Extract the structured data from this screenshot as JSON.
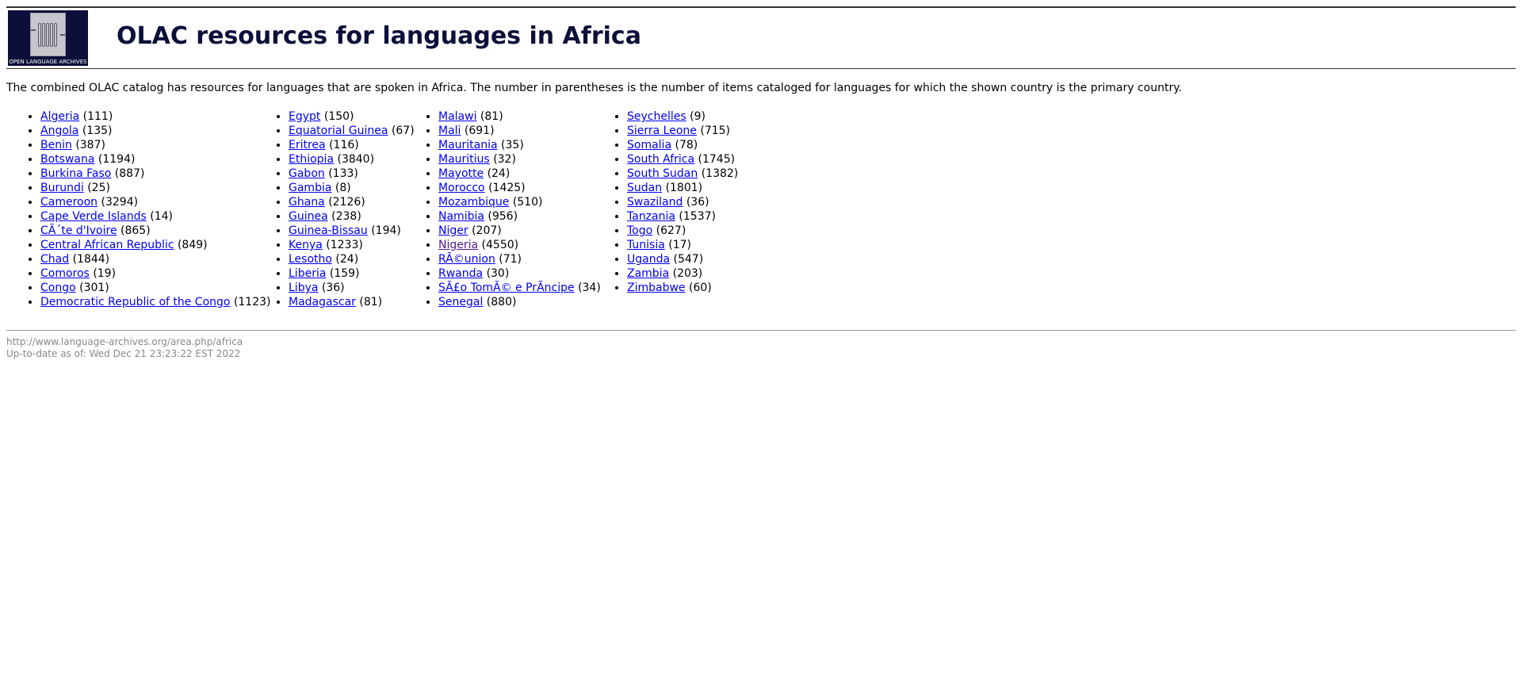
{
  "header": {
    "logo_text": "OPEN LANGUAGE ARCHIVES",
    "title": "OLAC resources for languages in Africa"
  },
  "intro": "The combined OLAC catalog has resources for languages that are spoken in Africa. The number in parentheses is the number of items cataloged for languages for which the shown country is the primary country.",
  "columns": [
    [
      {
        "name": "Algeria",
        "count": "(111)"
      },
      {
        "name": "Angola",
        "count": "(135)"
      },
      {
        "name": "Benin",
        "count": "(387)"
      },
      {
        "name": "Botswana",
        "count": "(1194)"
      },
      {
        "name": "Burkina Faso",
        "count": "(887)"
      },
      {
        "name": "Burundi",
        "count": "(25)"
      },
      {
        "name": "Cameroon",
        "count": "(3294)"
      },
      {
        "name": "Cape Verde Islands",
        "count": "(14)"
      },
      {
        "name": "CÃ´te d'Ivoire",
        "count": "(865)"
      },
      {
        "name": "Central African Republic",
        "count": "(849)"
      },
      {
        "name": "Chad",
        "count": "(1844)"
      },
      {
        "name": "Comoros",
        "count": "(19)"
      },
      {
        "name": "Congo",
        "count": "(301)"
      },
      {
        "name": "Democratic Republic of the Congo",
        "count": "(1123)"
      }
    ],
    [
      {
        "name": "Egypt",
        "count": "(150)"
      },
      {
        "name": "Equatorial Guinea",
        "count": "(67)"
      },
      {
        "name": "Eritrea",
        "count": "(116)"
      },
      {
        "name": "Ethiopia",
        "count": "(3840)"
      },
      {
        "name": "Gabon",
        "count": "(133)"
      },
      {
        "name": "Gambia",
        "count": "(8)"
      },
      {
        "name": "Ghana",
        "count": "(2126)"
      },
      {
        "name": "Guinea",
        "count": "(238)"
      },
      {
        "name": "Guinea-Bissau",
        "count": "(194)"
      },
      {
        "name": "Kenya",
        "count": "(1233)"
      },
      {
        "name": "Lesotho",
        "count": "(24)"
      },
      {
        "name": "Liberia",
        "count": "(159)"
      },
      {
        "name": "Libya",
        "count": "(36)"
      },
      {
        "name": "Madagascar",
        "count": "(81)"
      }
    ],
    [
      {
        "name": "Malawi",
        "count": "(81)"
      },
      {
        "name": "Mali",
        "count": "(691)"
      },
      {
        "name": "Mauritania",
        "count": "(35)"
      },
      {
        "name": "Mauritius",
        "count": "(32)"
      },
      {
        "name": "Mayotte",
        "count": "(24)"
      },
      {
        "name": "Morocco",
        "count": "(1425)"
      },
      {
        "name": "Mozambique",
        "count": "(510)"
      },
      {
        "name": "Namibia",
        "count": "(956)"
      },
      {
        "name": "Niger",
        "count": "(207)"
      },
      {
        "name": "Nigeria",
        "count": "(4550)",
        "visited": true
      },
      {
        "name": "RÃ©union",
        "count": "(71)"
      },
      {
        "name": "Rwanda",
        "count": "(30)"
      },
      {
        "name": "SÃ£o TomÃ© e PrÃ­ncipe",
        "count": "(34)"
      },
      {
        "name": "Senegal",
        "count": "(880)"
      }
    ],
    [
      {
        "name": "Seychelles",
        "count": "(9)"
      },
      {
        "name": "Sierra Leone",
        "count": "(715)"
      },
      {
        "name": "Somalia",
        "count": "(78)"
      },
      {
        "name": "South Africa",
        "count": "(1745)"
      },
      {
        "name": "South Sudan",
        "count": "(1382)"
      },
      {
        "name": "Sudan",
        "count": "(1801)"
      },
      {
        "name": "Swaziland",
        "count": "(36)"
      },
      {
        "name": "Tanzania",
        "count": "(1537)"
      },
      {
        "name": "Togo",
        "count": "(627)"
      },
      {
        "name": "Tunisia",
        "count": "(17)"
      },
      {
        "name": "Uganda",
        "count": "(547)"
      },
      {
        "name": "Zambia",
        "count": "(203)"
      },
      {
        "name": "Zimbabwe",
        "count": "(60)"
      }
    ]
  ],
  "footer": {
    "url": "http://www.language-archives.org/area.php/africa",
    "updated": "Up-to-date as of: Wed Dec 21 23:23:22 EST 2022"
  },
  "colors": {
    "title": "#0b0f3a",
    "link": "#0000ee",
    "visited_link": "#551a8b",
    "footer_text": "#888888"
  }
}
